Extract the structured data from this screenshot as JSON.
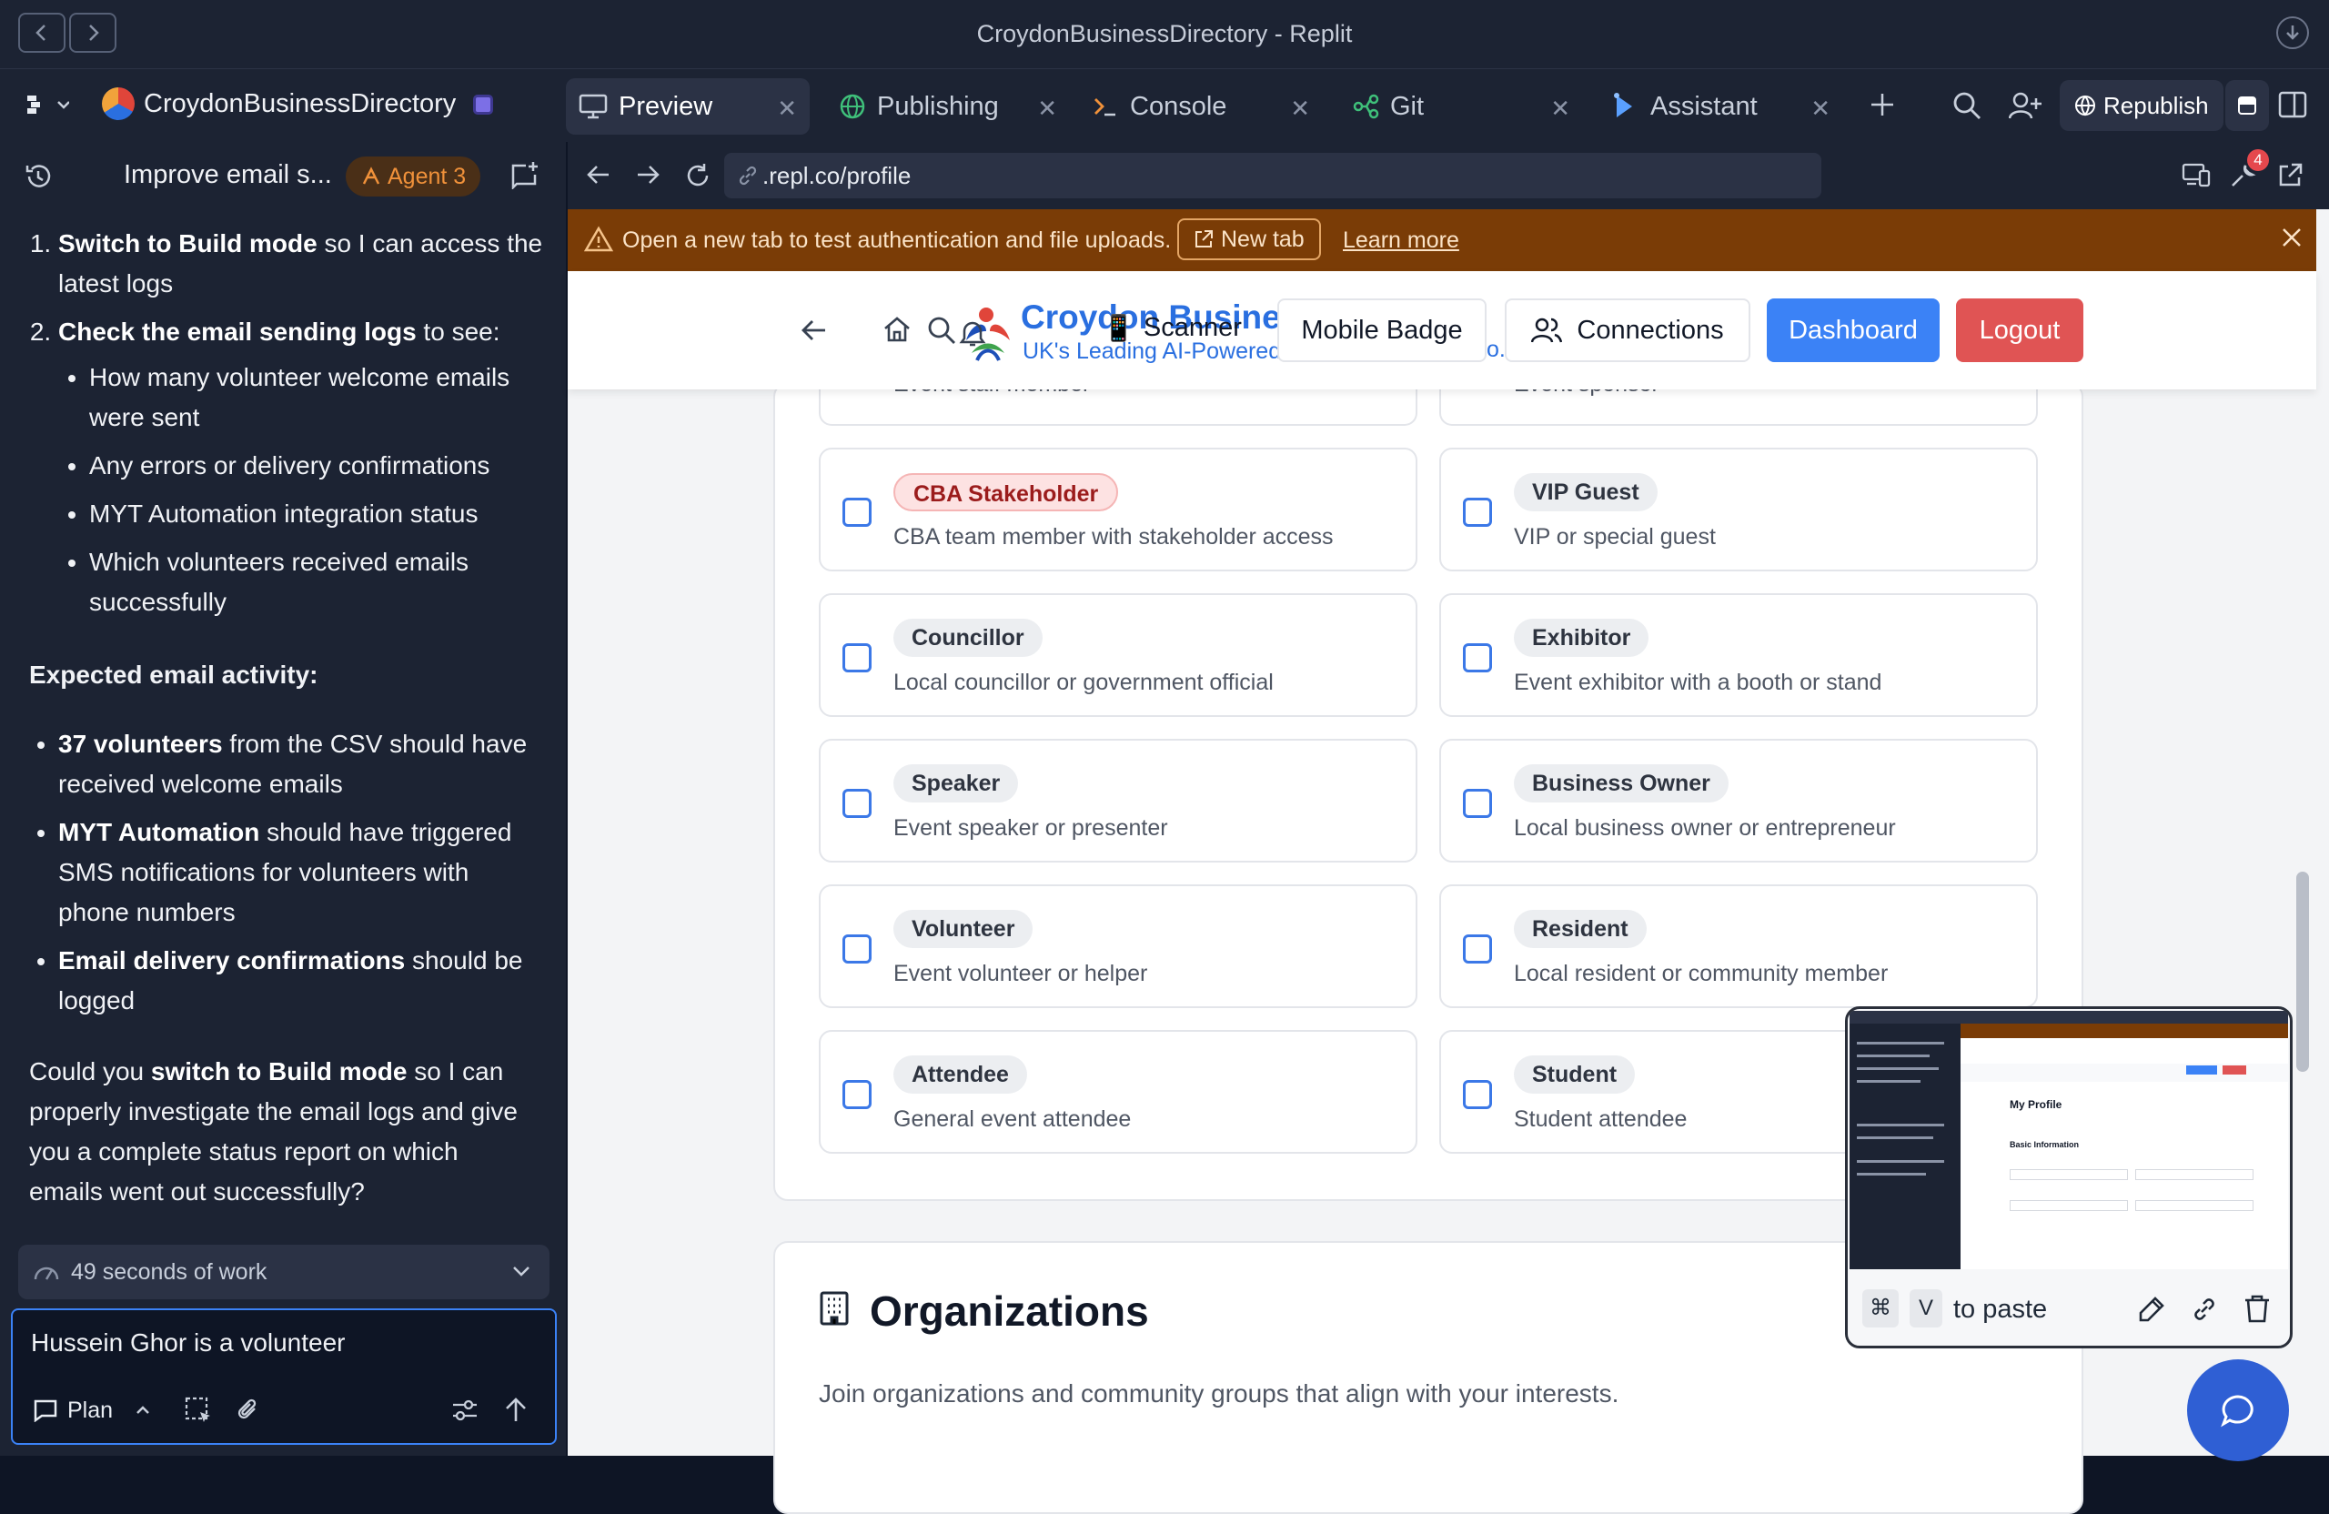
{
  "window": {
    "title": "CroydonBusinessDirectory - Replit"
  },
  "workspace": {
    "project_name": "CroydonBusinessDirectory"
  },
  "tabs": [
    {
      "label": "Preview",
      "icon": "monitor-icon"
    },
    {
      "label": "Publishing",
      "icon": "globe-icon"
    },
    {
      "label": "Console",
      "icon": "terminal-icon"
    },
    {
      "label": "Git",
      "icon": "git-icon"
    },
    {
      "label": "Assistant",
      "icon": "assistant-icon"
    }
  ],
  "toolbar": {
    "republish_label": "Republish",
    "badge_count": "4"
  },
  "chat_header": {
    "title": "Improve email s...",
    "agent_label": "Agent 3"
  },
  "chat": {
    "step1_bold": "Switch to Build mode",
    "step1_rest": " so I can access the latest logs",
    "step2_bold": "Check the email sending logs",
    "step2_rest": " to see:",
    "sub_items": [
      "How many volunteer welcome emails were sent",
      "Any errors or delivery confirmations",
      "MYT Automation integration status",
      "Which volunteers received emails successfully"
    ],
    "expected_heading": "Expected email activity:",
    "exp1_bold": "37 volunteers",
    "exp1_rest": " from the CSV should have received welcome emails",
    "exp2_bold": "MYT Automation",
    "exp2_rest": " should have triggered SMS notifications for volunteers with phone numbers",
    "exp3_bold": "Email delivery confirmations",
    "exp3_rest": " should be logged",
    "closing_pre": "Could you ",
    "closing_bold": "switch to Build mode",
    "closing_rest": " so I can properly investigate the email logs and give you a complete status report on which emails went out successfully?",
    "work_summary": "49 seconds of work"
  },
  "composer": {
    "value": "Hussein Ghor is a volunteer",
    "mode_label": "Plan"
  },
  "browser": {
    "url": ".repl.co/profile"
  },
  "notice": {
    "text": "Open a new tab to test authentication and file uploads.",
    "new_tab_label": "New tab",
    "learn_more_label": "Learn more"
  },
  "site": {
    "brand_name": "Croydon Busines",
    "brand_tagline": "UK's Leading AI-Powered",
    "scanner_label": "Scanner",
    "mobile_badge_label": "Mobile Badge",
    "connections_label": "Connections",
    "dashboard_label": "Dashboard",
    "logout_label": "Logout",
    "partial_left": "Event staff member",
    "partial_right": "Event sponsor",
    "trailing_char": "o."
  },
  "roles": [
    {
      "name": "CBA Stakeholder",
      "desc": "CBA team member with stakeholder access",
      "highlight": true
    },
    {
      "name": "VIP Guest",
      "desc": "VIP or special guest"
    },
    {
      "name": "Councillor",
      "desc": "Local councillor or government official"
    },
    {
      "name": "Exhibitor",
      "desc": "Event exhibitor with a booth or stand"
    },
    {
      "name": "Speaker",
      "desc": "Event speaker or presenter"
    },
    {
      "name": "Business Owner",
      "desc": "Local business owner or entrepreneur"
    },
    {
      "name": "Volunteer",
      "desc": "Event volunteer or helper"
    },
    {
      "name": "Resident",
      "desc": "Local resident or community member"
    },
    {
      "name": "Attendee",
      "desc": "General event attendee"
    },
    {
      "name": "Student",
      "desc": "Student attendee"
    }
  ],
  "organizations": {
    "title": "Organizations",
    "desc": "Join organizations and community groups that align with your interests."
  },
  "clipboard": {
    "key1": "⌘",
    "key2": "V",
    "paste_label": "to paste"
  },
  "thumbnail": {
    "title": "My Profile",
    "section": "Basic Information"
  },
  "colors": {
    "accent_blue": "#3b82f6",
    "logout_red": "#e05454",
    "agent_orange": "#f0913a",
    "notice_bg": "#7a3c06",
    "stakeholder_pill": "#fde2e2"
  }
}
